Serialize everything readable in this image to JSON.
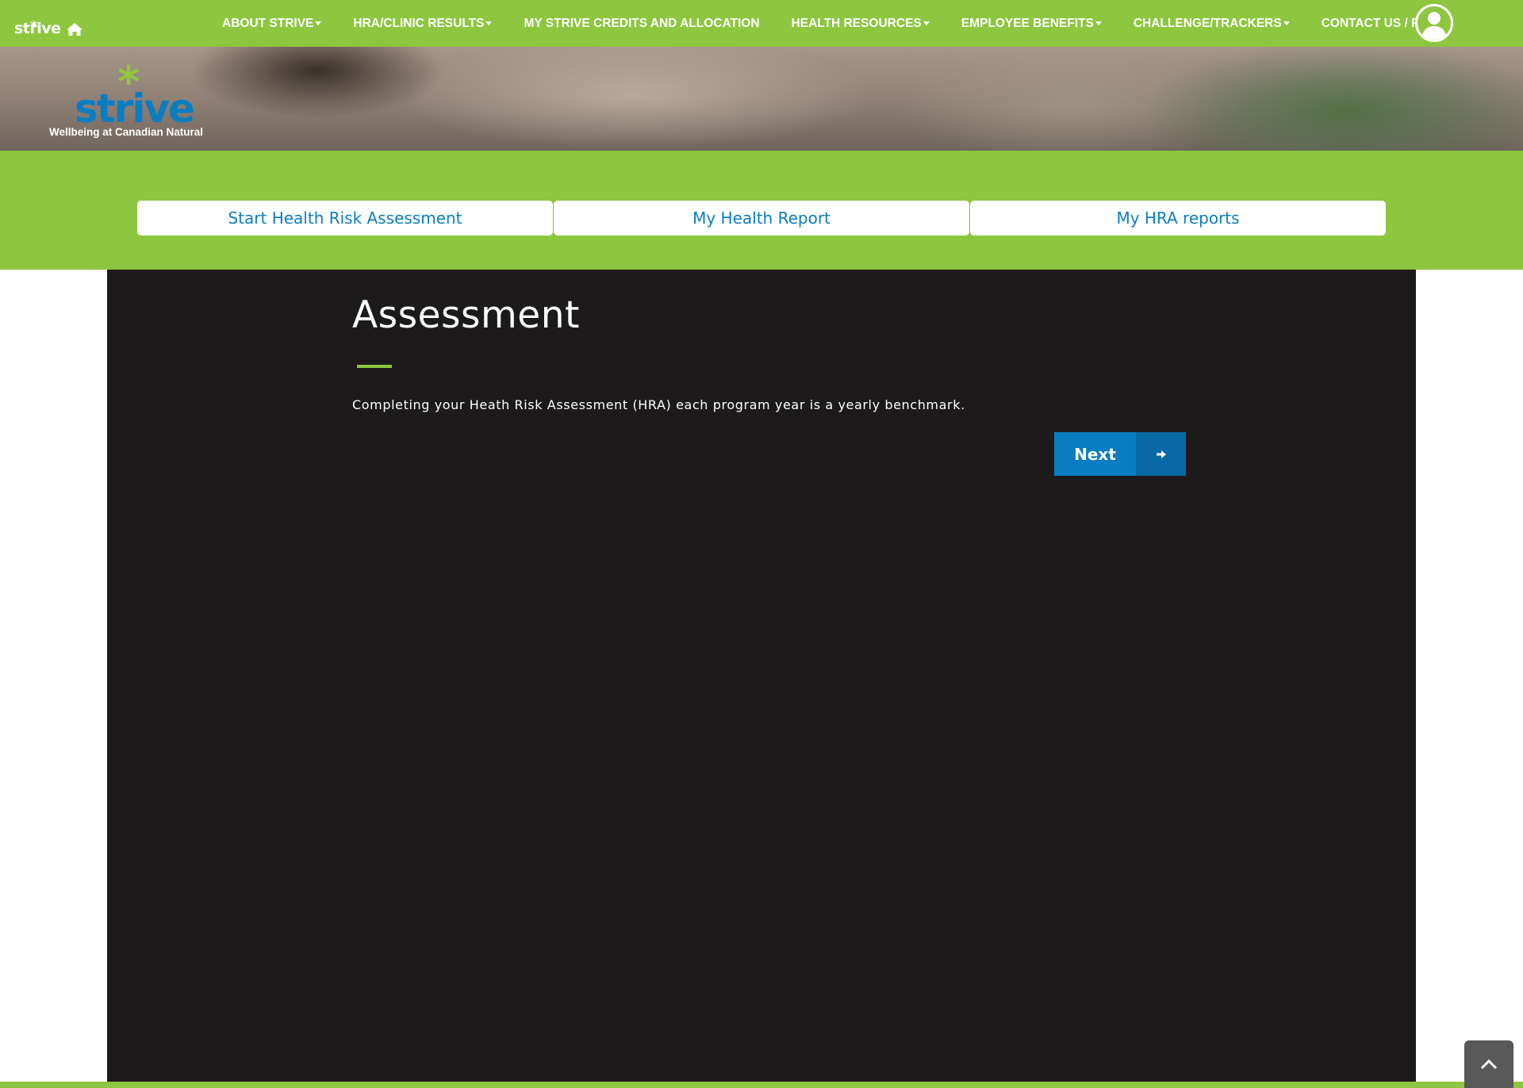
{
  "brand": {
    "nav_logo_text": "strive",
    "nav_logo_star": "*",
    "hero_logo_text": "strive",
    "hero_logo_star": "*",
    "tagline": "Wellbeing at Canadian Natural",
    "primary_color": "#8dc63f",
    "accent_color": "#0a7dc2"
  },
  "nav": {
    "home_icon": "home-icon",
    "items": [
      {
        "label": "ABOUT STRIVE",
        "has_dropdown": true
      },
      {
        "label": "HRA/CLINIC RESULTS",
        "has_dropdown": true
      },
      {
        "label": "MY STRIVE CREDITS AND ALLOCATION",
        "has_dropdown": false
      },
      {
        "label": "HEALTH RESOURCES",
        "has_dropdown": true
      },
      {
        "label": "EMPLOYEE BENEFITS",
        "has_dropdown": true
      },
      {
        "label": "CHALLENGE/TRACKERS",
        "has_dropdown": true
      },
      {
        "label": "CONTACT US / FAQ",
        "has_dropdown": false
      }
    ],
    "user_icon": "user-avatar-icon"
  },
  "tabs": [
    {
      "label": "Start Health Risk Assessment"
    },
    {
      "label": "My Health Report"
    },
    {
      "label": "My HRA reports"
    }
  ],
  "main": {
    "title": "Assessment",
    "intro": "Completing your Heath Risk Assessment (HRA) each program year is a yearly benchmark.",
    "next_label": "Next",
    "next_icon": "arrow-right-icon"
  },
  "scroll_top_icon": "chevron-up-icon"
}
